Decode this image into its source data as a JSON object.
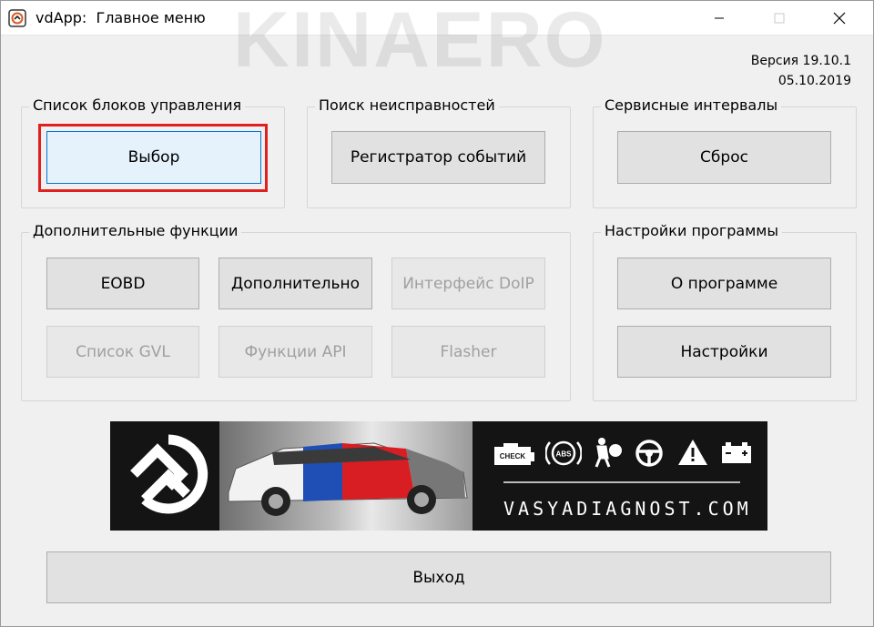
{
  "window": {
    "title": "vdApp:  Главное меню",
    "watermark": "KINAERO"
  },
  "version": {
    "line1": "Версия 19.10.1",
    "line2": "05.10.2019"
  },
  "groups": {
    "control_units": {
      "label": "Список блоков управления",
      "select_label": "Выбор"
    },
    "fault_search": {
      "label": "Поиск неисправностей",
      "event_recorder_label": "Регистратор событий"
    },
    "service_intervals": {
      "label": "Сервисные интервалы",
      "reset_label": "Сброс"
    },
    "extra_functions": {
      "label": "Дополнительные функции",
      "eobd_label": "EOBD",
      "additional_label": "Дополнительно",
      "doip_label": "Интерфейс DoIP",
      "gvl_label": "Список GVL",
      "api_label": "Функции API",
      "flasher_label": "Flasher"
    },
    "settings": {
      "label": "Настройки программы",
      "about_label": "О программе",
      "settings_label": "Настройки"
    }
  },
  "banner": {
    "site": "VASYADIAGNOST.COM",
    "check_label": "CHECK",
    "abs_label": "ABS"
  },
  "exit_label": "Выход",
  "colors": {
    "highlight": "#e0201e",
    "focus": "#0078d7"
  }
}
